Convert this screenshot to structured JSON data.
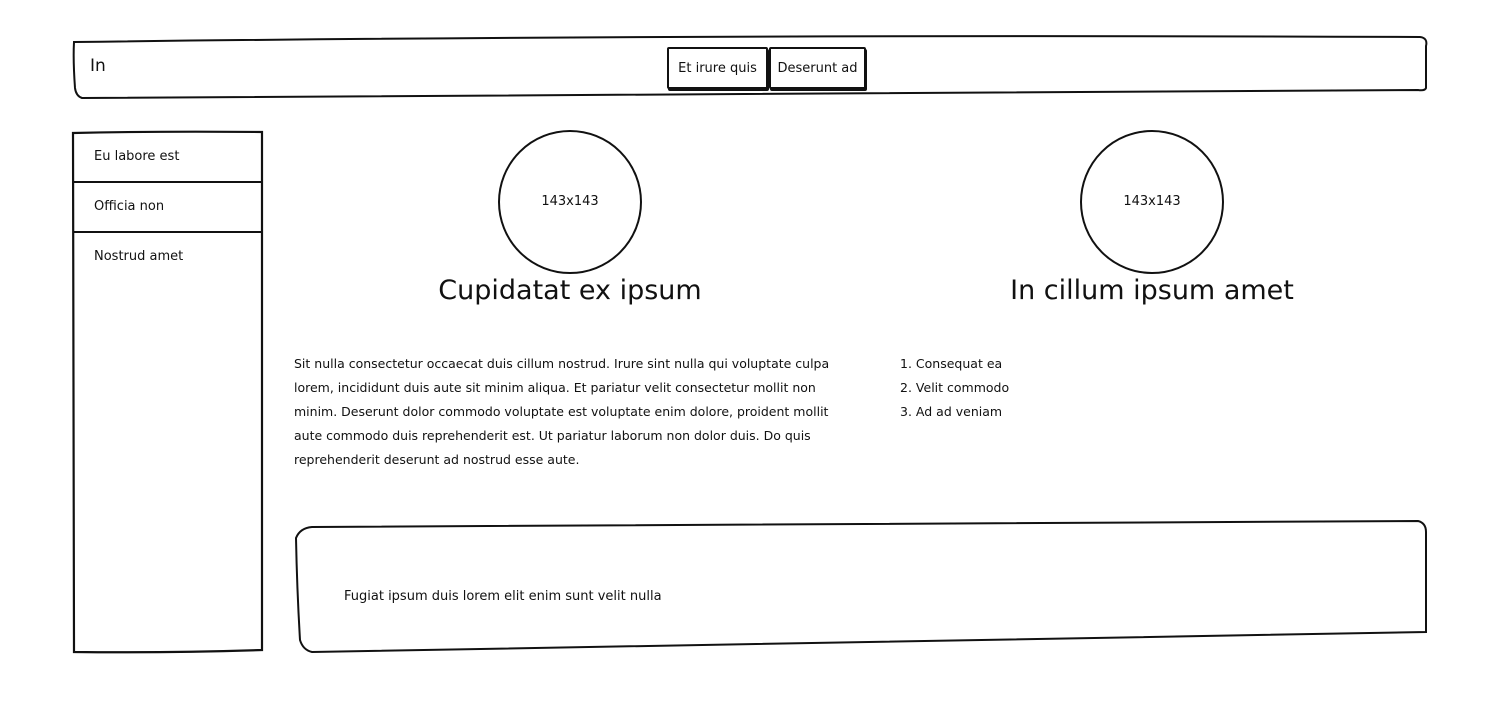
{
  "header": {
    "brand": "In",
    "nav": [
      {
        "label": "Et irure quis"
      },
      {
        "label": "Deserunt ad"
      }
    ]
  },
  "sidebar": {
    "items": [
      {
        "label": "Eu labore est"
      },
      {
        "label": "Officia non"
      },
      {
        "label": "Nostrud amet"
      }
    ]
  },
  "columns": [
    {
      "image_placeholder": "143x143",
      "heading": "Cupidatat ex ipsum"
    },
    {
      "image_placeholder": "143x143",
      "heading": "In cillum ipsum amet"
    }
  ],
  "paragraph": "Sit nulla consectetur occaecat duis cillum nostrud. Irure sint nulla qui voluptate culpa lorem, incididunt duis aute sit minim aliqua. Et pariatur velit consectetur mollit non minim. Deserunt dolor commodo voluptate est voluptate enim dolore, proident mollit aute commodo duis reprehenderit est. Ut pariatur laborum non dolor duis. Do quis reprehenderit deserunt ad nostrud esse aute.",
  "ordered_list": [
    {
      "num": "1.",
      "text": "Consequat ea"
    },
    {
      "num": "2.",
      "text": "Velit commodo"
    },
    {
      "num": "3.",
      "text": "Ad ad veniam"
    }
  ],
  "footer": {
    "text": "Fugiat ipsum duis lorem elit enim sunt velit nulla"
  }
}
